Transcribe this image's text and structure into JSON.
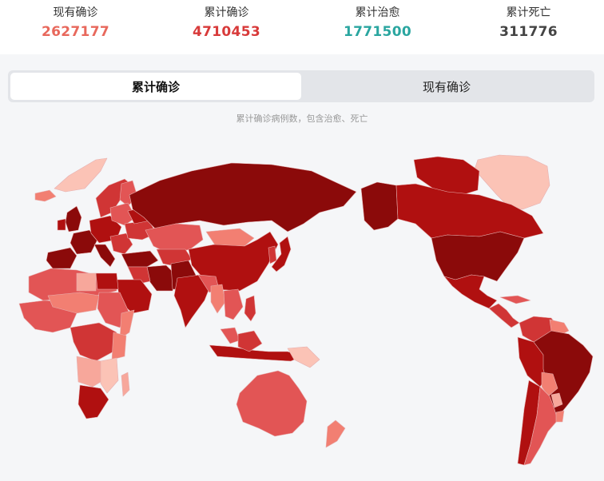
{
  "stats": [
    {
      "label": "现有确诊",
      "value": "2627177",
      "color": "#e8685c"
    },
    {
      "label": "累计确诊",
      "value": "4710453",
      "color": "#d83a3a"
    },
    {
      "label": "累计治愈",
      "value": "1771500",
      "color": "#2aa6a0"
    },
    {
      "label": "累计死亡",
      "value": "311776",
      "color": "#444444"
    }
  ],
  "tabs": [
    {
      "label": "累计确诊",
      "active": true
    },
    {
      "label": "现有确诊",
      "active": false
    }
  ],
  "subtitle": "累计确诊病例数，包含治愈、死亡",
  "legend_colors": {
    "highest": "#8b0a0a",
    "very_high": "#b01010",
    "high": "#d03535",
    "medium": "#e25555",
    "low": "#f27f72",
    "lower": "#f7a79b",
    "lowest": "#fbc3b6"
  }
}
